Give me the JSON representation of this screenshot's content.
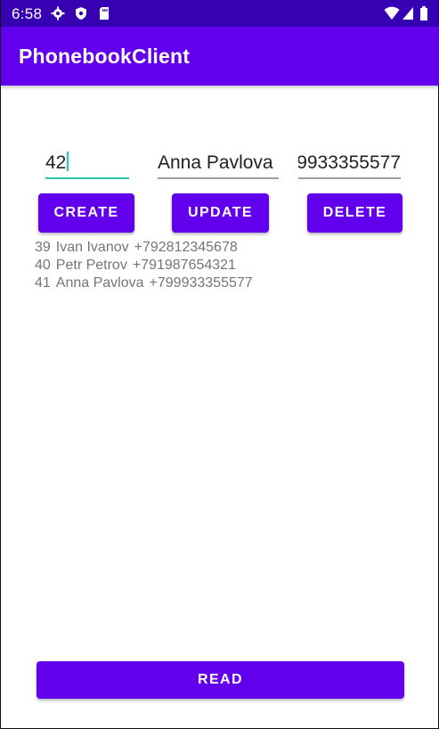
{
  "status_bar": {
    "time": "6:58",
    "left_icons": [
      "gear-icon",
      "shield-icon",
      "sd-card-icon"
    ],
    "right_icons": [
      "wifi-icon",
      "signal-icon",
      "battery-icon"
    ]
  },
  "app_bar": {
    "title": "PhonebookClient"
  },
  "inputs": {
    "id_value": "42",
    "name_value": "Anna Pavlova",
    "phone_value": "9933355577"
  },
  "buttons": {
    "create": "CREATE",
    "update": "UPDATE",
    "delete": "DELETE",
    "read": "READ"
  },
  "contacts": [
    {
      "id": "39",
      "name": "Ivan Ivanov",
      "phone": "+792812345678"
    },
    {
      "id": "40",
      "name": "Petr Petrov",
      "phone": "+791987654321"
    },
    {
      "id": "41",
      "name": "Anna Pavlova",
      "phone": "+799933355577"
    }
  ],
  "colors": {
    "status_bar": "#3700B3",
    "primary": "#6200EE",
    "accent": "#26C6B0"
  }
}
